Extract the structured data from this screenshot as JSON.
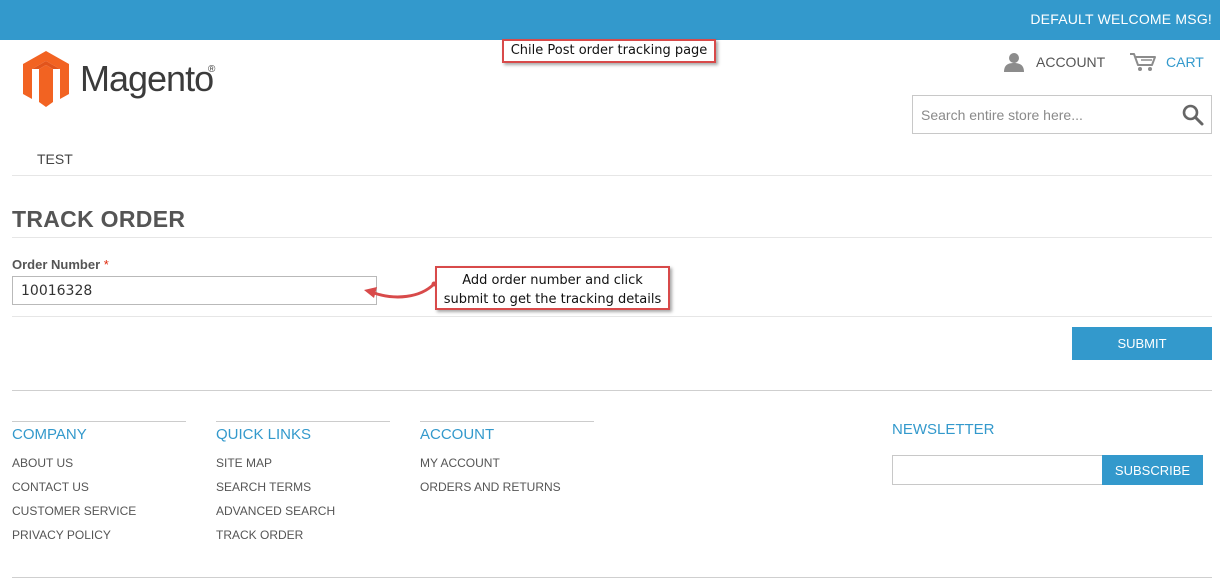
{
  "header": {
    "welcome": "DEFAULT WELCOME MSG!",
    "logo_text": "Magento",
    "logo_mark": "®",
    "account_label": "ACCOUNT",
    "cart_label": "CART"
  },
  "annotations": {
    "page_label": "Chile Post order tracking page",
    "note_line1": "Add order number and click",
    "note_line2": "submit to get the tracking details"
  },
  "search": {
    "placeholder": "Search entire store here..."
  },
  "nav": {
    "items": [
      {
        "label": "TEST"
      }
    ]
  },
  "main": {
    "title": "TRACK ORDER",
    "order_label": "Order Number",
    "required_mark": "*",
    "order_value": "10016328",
    "submit_label": "SUBMIT"
  },
  "footer": {
    "columns": [
      {
        "title": "COMPANY",
        "links": [
          "ABOUT US",
          "CONTACT US",
          "CUSTOMER SERVICE",
          "PRIVACY POLICY"
        ]
      },
      {
        "title": "QUICK LINKS",
        "links": [
          "SITE MAP",
          "SEARCH TERMS",
          "ADVANCED SEARCH",
          "TRACK ORDER"
        ]
      },
      {
        "title": "ACCOUNT",
        "links": [
          "MY ACCOUNT",
          "ORDERS AND RETURNS"
        ]
      }
    ],
    "newsletter": {
      "title": "NEWSLETTER",
      "subscribe_label": "SUBSCRIBE"
    }
  },
  "colors": {
    "brand": "#3399cc",
    "logo_orange": "#f26322",
    "annotation_border": "#d84a4a"
  },
  "icons": {
    "account": "user-icon",
    "cart": "cart-icon",
    "search": "search-icon",
    "logo": "magento-logo-icon"
  }
}
